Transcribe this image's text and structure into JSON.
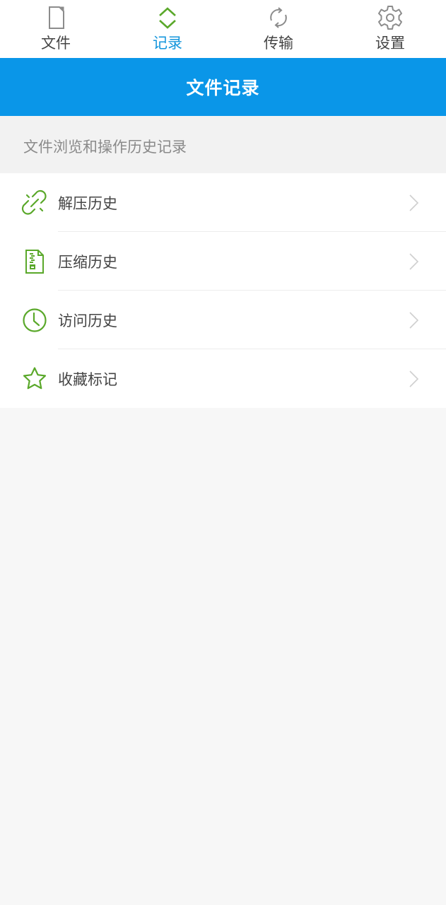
{
  "tabs": [
    {
      "label": "文件",
      "icon": "file-icon",
      "active": false
    },
    {
      "label": "记录",
      "icon": "up-down-chevron-icon",
      "active": true
    },
    {
      "label": "传输",
      "icon": "sync-icon",
      "active": false
    },
    {
      "label": "设置",
      "icon": "gear-icon",
      "active": false
    }
  ],
  "header": {
    "title": "文件记录"
  },
  "subheader": {
    "text": "文件浏览和操作历史记录"
  },
  "menu": [
    {
      "label": "解压历史",
      "icon": "link-icon"
    },
    {
      "label": "压缩历史",
      "icon": "zip-file-icon"
    },
    {
      "label": "访问历史",
      "icon": "clock-icon"
    },
    {
      "label": "收藏标记",
      "icon": "star-icon"
    }
  ],
  "colors": {
    "accent": "#0a96e8",
    "active_tab_text": "#1496dc",
    "icon_green": "#5aa82a",
    "icon_gray": "#8c8c8c"
  }
}
